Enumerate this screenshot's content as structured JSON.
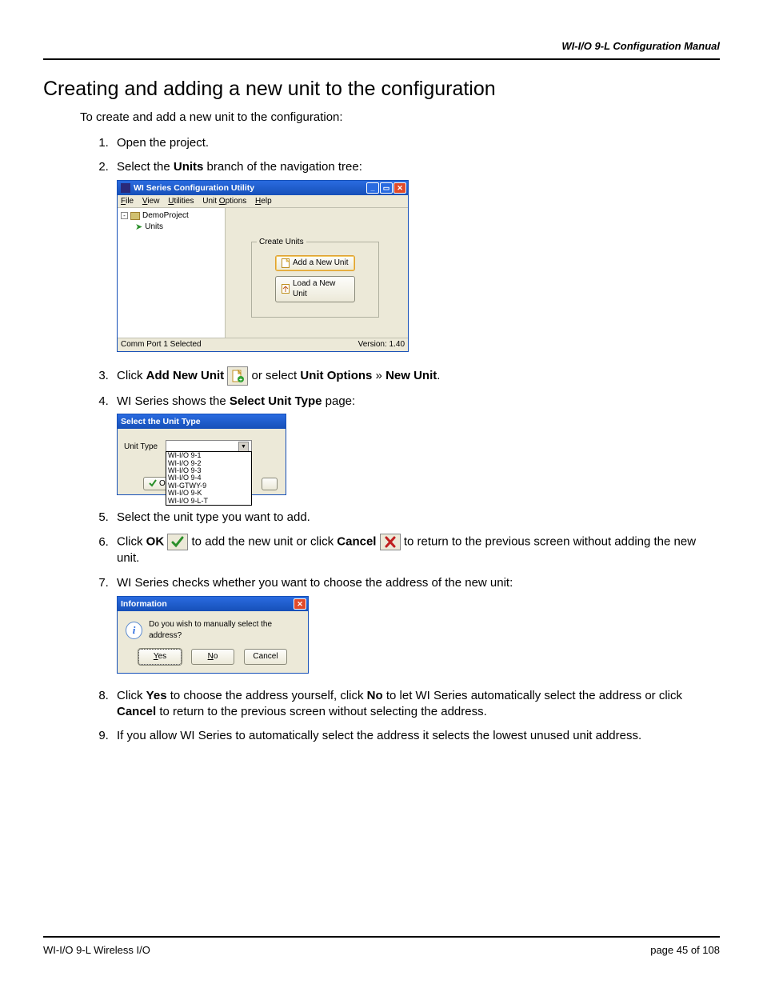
{
  "header": {
    "doc_title": "WI-I/O 9-L Configuration Manual"
  },
  "section": {
    "title": "Creating and adding a new unit to the configuration",
    "intro": "To create and add a new unit to the configuration:"
  },
  "steps": {
    "s1": "Open the project.",
    "s2_a": "Select the ",
    "s2_b": "Units",
    "s2_c": " branch of the navigation tree:",
    "s3_a": "Click ",
    "s3_b": "Add New Unit",
    "s3_c": " or select ",
    "s3_d": "Unit Options",
    "s3_e": " » ",
    "s3_f": "New Unit",
    "s3_g": ".",
    "s4_a": "WI Series shows the ",
    "s4_b": "Select Unit Type",
    "s4_c": " page:",
    "s5": "Select the unit type you want to add.",
    "s6_a": "Click ",
    "s6_b": "OK",
    "s6_c": " to add the new unit or click ",
    "s6_d": "Cancel",
    "s6_e": " to return to the previous screen without adding the new unit.",
    "s7": "WI Series checks whether you want to choose the address of the new unit:",
    "s8_a": "Click ",
    "s8_b": "Yes",
    "s8_c": " to choose the address yourself, click ",
    "s8_d": "No",
    "s8_e": " to let WI Series automatically select the address or click ",
    "s8_f": "Cancel",
    "s8_g": " to return to the previous screen without selecting the address.",
    "s9": "If you allow WI Series to automatically select the address it selects the lowest unused unit address."
  },
  "win1": {
    "title": "WI Series Configuration Utility",
    "menu": {
      "file": "File",
      "view": "View",
      "utilities": "Utilities",
      "unitoptions": "Unit Options",
      "help": "Help"
    },
    "tree": {
      "project": "DemoProject",
      "units": "Units"
    },
    "group_legend": "Create Units",
    "btn_add": "Add a New Unit",
    "btn_load": "Load a New Unit",
    "status_left": "Comm Port 1 Selected",
    "status_right": "Version: 1.40"
  },
  "win2": {
    "title": "Select the Unit Type",
    "label": "Unit Type",
    "options": [
      "WI-I/O 9-1",
      "WI-I/O 9-2",
      "WI-I/O 9-3",
      "WI-I/O 9-4",
      "WI-GTWY-9",
      "WI-I/O 9-K",
      "WI-I/O 9-L-T"
    ],
    "ok": "OK"
  },
  "win3": {
    "title": "Information",
    "msg": "Do you wish to manually select the address?",
    "yes": "Yes",
    "no": "No",
    "cancel": "Cancel"
  },
  "footer": {
    "left": "WI-I/O 9-L Wireless I/O",
    "right_a": "page  ",
    "right_b": "45",
    "right_c": " of 108"
  }
}
